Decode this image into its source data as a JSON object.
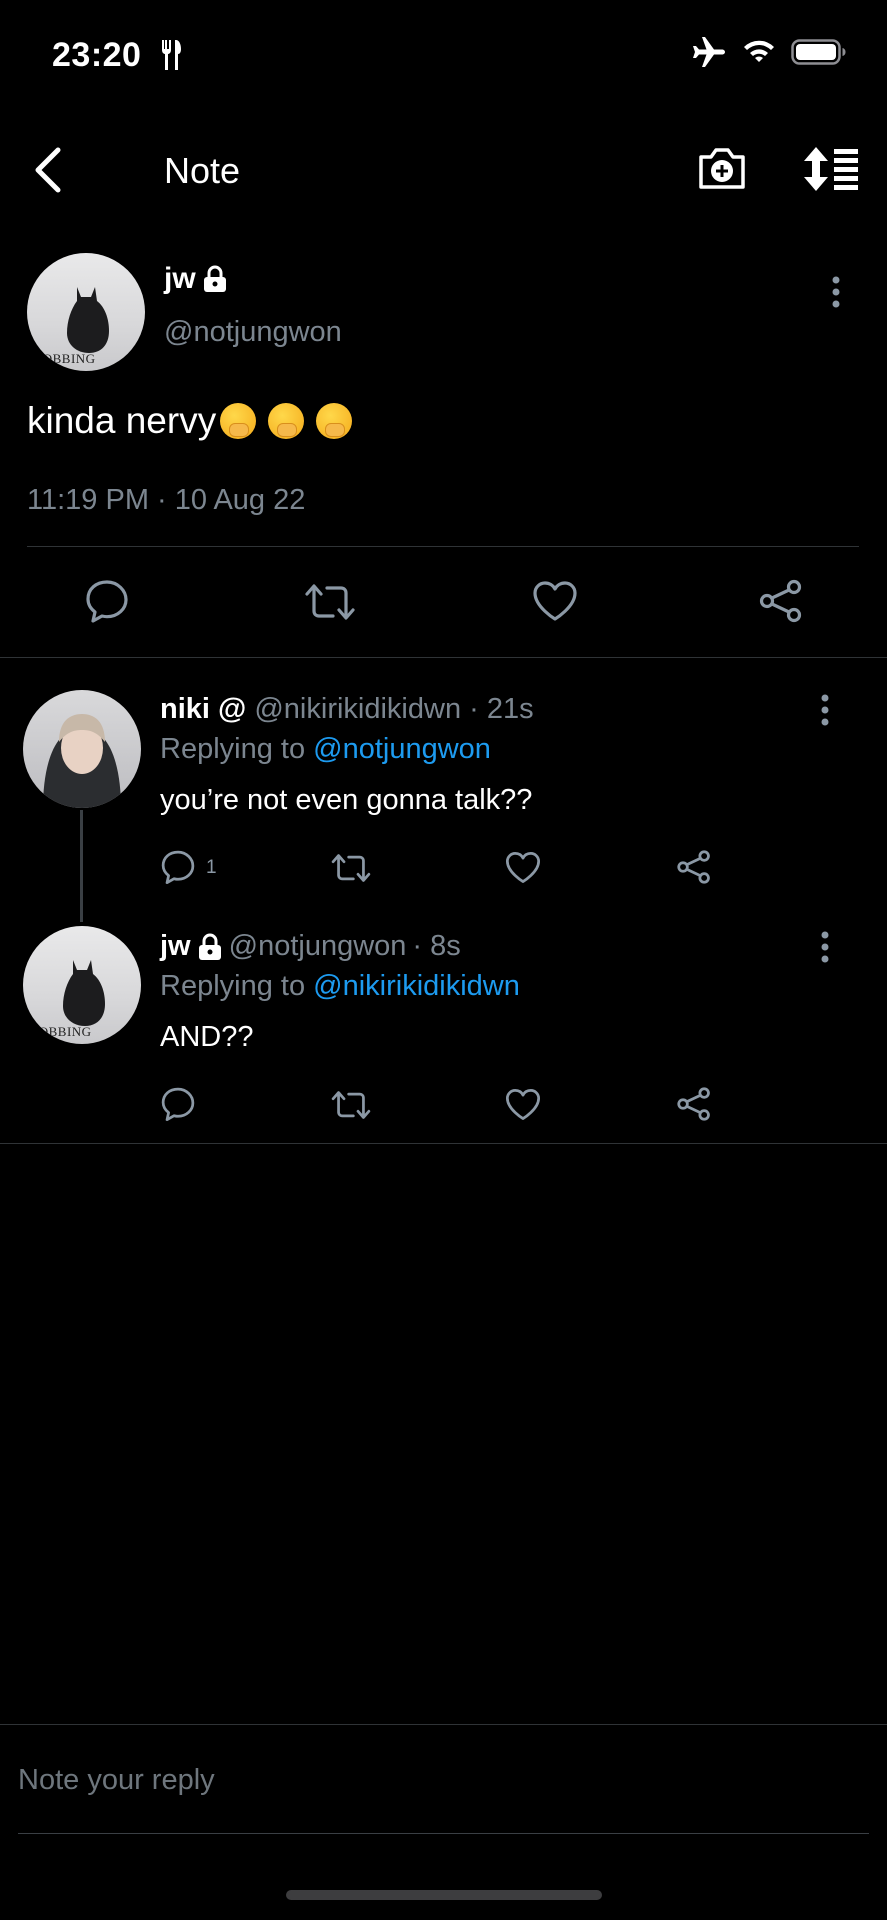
{
  "status_bar": {
    "time": "23:20"
  },
  "nav": {
    "title": "Note"
  },
  "main_note": {
    "name": "jw",
    "handle": "@notjungwon",
    "avatar_caption": "SOBBING",
    "text": "kinda nervy",
    "emoji_count": 3,
    "timestamp": "11:19 PM · 10 Aug 22"
  },
  "replies": [
    {
      "name": "niki @",
      "handle": "@nikirikidikidwn",
      "age": "· 21s",
      "replying_prefix": "Replying to",
      "replying_to": "@notjungwon",
      "text": "you’re not even gonna talk??",
      "comment_count": "1"
    },
    {
      "name": "jw",
      "handle": "@notjungwon",
      "age": "· 8s",
      "replying_prefix": "Replying to",
      "replying_to": "@nikirikidikidwn",
      "text": "AND??",
      "avatar_caption": "SOBBING"
    }
  ],
  "compose": {
    "placeholder": "Note your reply"
  },
  "colors": {
    "accent": "#1d9bf0",
    "muted": "#7c8690",
    "divider": "#2f3336"
  }
}
